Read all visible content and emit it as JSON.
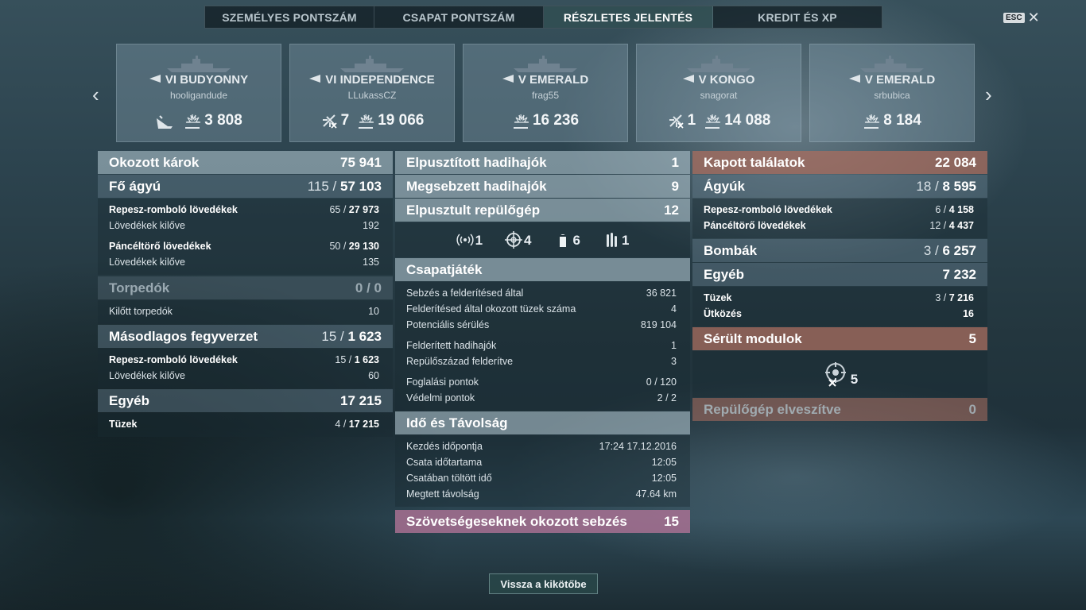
{
  "tabs": [
    {
      "label": "SZEMÉLYES PONTSZÁM",
      "active": false
    },
    {
      "label": "CSAPAT PONTSZÁM",
      "active": false
    },
    {
      "label": "RÉSZLETES JELENTÉS",
      "active": true
    },
    {
      "label": "KREDIT ÉS XP",
      "active": false
    }
  ],
  "esc": {
    "key": "ESC",
    "close": "✕"
  },
  "nav": {
    "prev": "‹",
    "next": "›"
  },
  "cards": [
    {
      "name": "VI BUDYONNY",
      "player": "hooligandude",
      "stats": [
        {
          "icon": "sinking-ship-icon",
          "value": ""
        },
        {
          "icon": "damage-burst-icon",
          "value": "3 808"
        }
      ]
    },
    {
      "name": "VI INDEPENDENCE",
      "player": "LLukassCZ",
      "stats": [
        {
          "icon": "plane-destroyed-icon",
          "value": "7"
        },
        {
          "icon": "damage-burst-icon",
          "value": "19 066"
        }
      ]
    },
    {
      "name": "V EMERALD",
      "player": "frag55",
      "stats": [
        {
          "icon": "damage-burst-icon",
          "value": "16 236"
        }
      ]
    },
    {
      "name": "V KONGO",
      "player": "snagorat",
      "stats": [
        {
          "icon": "plane-destroyed-icon",
          "value": "1"
        },
        {
          "icon": "damage-burst-icon",
          "value": "14 088"
        }
      ]
    },
    {
      "name": "V EMERALD",
      "player": "srbubica",
      "stats": [
        {
          "icon": "damage-burst-icon",
          "value": "8 184"
        }
      ]
    }
  ],
  "left": {
    "damage": {
      "label": "Okozott károk",
      "value": "75 941"
    },
    "main_guns": {
      "label": "Fő ágyú",
      "hits": "115",
      "value": "57 103"
    },
    "he_label": "Repesz-romboló lövedékek",
    "he_hits": "65",
    "he_value": "27 973",
    "he_fired_label": "Lövedékek kilőve",
    "he_fired": "192",
    "ap_label": "Páncéltörő lövedékek",
    "ap_hits": "50",
    "ap_value": "29 130",
    "ap_fired_label": "Lövedékek kilőve",
    "ap_fired": "135",
    "torpedoes": {
      "label": "Torpedók",
      "hits": "0",
      "value": "0"
    },
    "torp_fired_label": "Kilőtt torpedók",
    "torp_fired": "10",
    "secondary": {
      "label": "Másodlagos fegyverzet",
      "hits": "15",
      "value": "1 623"
    },
    "sec_he_label": "Repesz-romboló lövedékek",
    "sec_he_hits": "15",
    "sec_he_value": "1 623",
    "sec_fired_label": "Lövedékek kilőve",
    "sec_fired": "60",
    "other": {
      "label": "Egyéb",
      "value": "17 215"
    },
    "fires_label": "Tüzek",
    "fires_hits": "4",
    "fires_value": "17 215"
  },
  "middle": {
    "destroyed": {
      "label": "Elpusztított hadihajók",
      "value": "1"
    },
    "damaged": {
      "label": "Megsebzett hadihajók",
      "value": "9"
    },
    "planes": {
      "label": "Elpusztult repülőgép",
      "value": "12"
    },
    "icons": [
      {
        "icon": "radar-icon",
        "value": "1"
      },
      {
        "icon": "crosshair-icon",
        "value": "4"
      },
      {
        "icon": "shell-icon",
        "value": "6"
      },
      {
        "icon": "torpedo-icon",
        "value": "1"
      }
    ],
    "teamplay": {
      "label": "Csapatjáték"
    },
    "tp_rows": [
      {
        "label": "Sebzés a felderítésed által",
        "value": "36 821"
      },
      {
        "label": "Felderítésed által okozott tüzek száma",
        "value": "4"
      },
      {
        "label": "Potenciális sérülés",
        "value": "819 104"
      },
      {
        "label": "Felderített hadihajók",
        "value": "1"
      },
      {
        "label": "Repülőszázad felderítve",
        "value": "3"
      },
      {
        "label": "Foglalási pontok",
        "value": "0 / 120"
      },
      {
        "label": "Védelmi pontok",
        "value": "2 / 2"
      }
    ],
    "time": {
      "label": "Idő és Távolság"
    },
    "time_rows": [
      {
        "label": "Kezdés időpontja",
        "value": "17:24  17.12.2016"
      },
      {
        "label": "Csata időtartama",
        "value": "12:05"
      },
      {
        "label": "Csatában töltött idő",
        "value": "12:05"
      },
      {
        "label": "Megtett távolság",
        "value": "47.64 km"
      }
    ],
    "allied": {
      "label": "Szövetségeseknek okozott sebzés",
      "value": "15"
    }
  },
  "right": {
    "received": {
      "label": "Kapott találatok",
      "value": "22 084"
    },
    "guns": {
      "label": "Ágyúk",
      "hits": "18",
      "value": "8 595"
    },
    "he_label": "Repesz-romboló lövedékek",
    "he_hits": "6",
    "he_value": "4 158",
    "ap_label": "Páncéltörő lövedékek",
    "ap_hits": "12",
    "ap_value": "4 437",
    "bombs": {
      "label": "Bombák",
      "hits": "3",
      "value": "6 257"
    },
    "other": {
      "label": "Egyéb",
      "value": "7 232"
    },
    "fires_label": "Tüzek",
    "fires_hits": "3",
    "fires_value": "7 216",
    "ram_label": "Ütközés",
    "ram_value": "16",
    "modules": {
      "label": "Sérült modulok",
      "value": "5"
    },
    "module_icon_value": "5",
    "planes_lost": {
      "label": "Repülőgép elveszítve",
      "value": "0"
    }
  },
  "back_button": "Vissza a kikötőbe"
}
